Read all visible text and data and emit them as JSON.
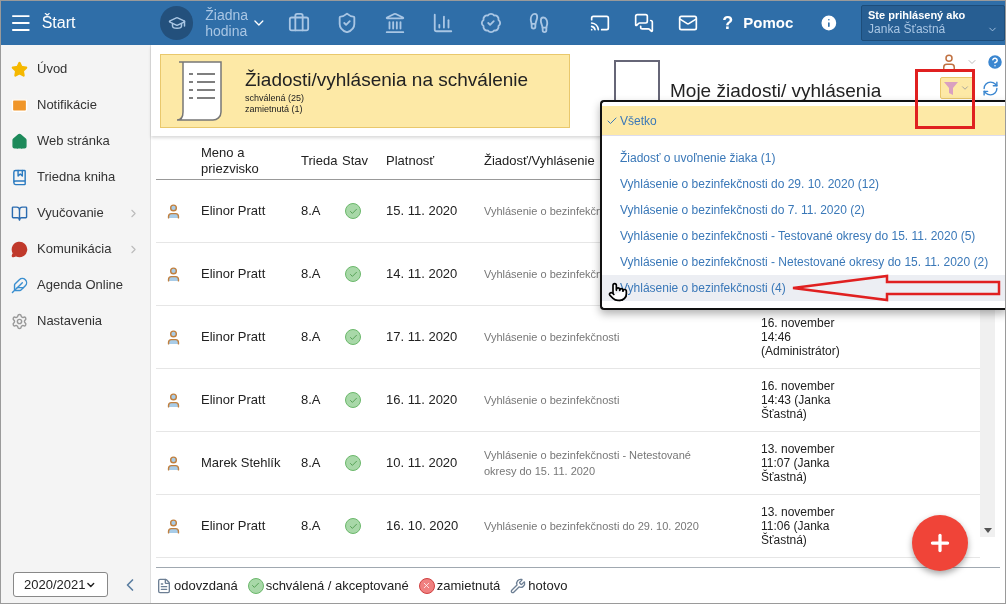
{
  "topbar": {
    "title": "Štart",
    "lesson": "Žiadna hodina",
    "help_mark": "?",
    "help": "Pomoc",
    "user_label": "Ste prihlásený ako",
    "user_name": "Janka Šťastná"
  },
  "sidebar": {
    "items": [
      {
        "label": "Úvod",
        "has_submenu": false
      },
      {
        "label": "Notifikácie",
        "has_submenu": false
      },
      {
        "label": "Web stránka",
        "has_submenu": false
      },
      {
        "label": "Triedna kniha",
        "has_submenu": false
      },
      {
        "label": "Vyučovanie",
        "has_submenu": true
      },
      {
        "label": "Komunikácia",
        "has_submenu": true
      },
      {
        "label": "Agenda Online",
        "has_submenu": false
      },
      {
        "label": "Nastavenia",
        "has_submenu": false
      }
    ],
    "year": "2020/2021"
  },
  "cards": [
    {
      "title": "Žiadosti/vyhlásenia na schválenie",
      "lines": [
        "schválená (25)",
        "zamietnutá (1)"
      ],
      "selected": true
    },
    {
      "title": "Moje žiadosti/ vyhlásenia",
      "selected": false
    }
  ],
  "table": {
    "columns": [
      "Meno a priezvisko",
      "Trieda",
      "Stav",
      "Platnosť",
      "Žiadosť/Vyhlásenie"
    ],
    "rows": [
      {
        "name": "Elinor Pratt",
        "class": "8.A",
        "approved": true,
        "validity": "15. 11. 2020",
        "request": "Vyhlásenie o bezinfekčn"
      },
      {
        "name": "Elinor Pratt",
        "class": "8.A",
        "approved": true,
        "validity": "14. 11. 2020",
        "request": "Vyhlásenie o bezinfekčn"
      },
      {
        "name": "Elinor Pratt",
        "class": "8.A",
        "approved": true,
        "validity": "17. 11. 2020",
        "request": "Vyhlásenie o bezinfekčnosti",
        "changed": "16. november 14:46 (Administrátor)"
      },
      {
        "name": "Elinor Pratt",
        "class": "8.A",
        "approved": true,
        "validity": "16. 11. 2020",
        "request": "Vyhlásenie o bezinfekčnosti",
        "changed": "16. november 14:43 (Janka Šťastná)"
      },
      {
        "name": "Marek Stehlík",
        "class": "8.A",
        "approved": true,
        "validity": "10. 11. 2020",
        "request": "Vyhlásenie o bezinfekčnosti - Netestované okresy do 15. 11. 2020",
        "changed": "13. november 11:07 (Janka Šťastná)"
      },
      {
        "name": "Elinor Pratt",
        "class": "8.A",
        "approved": true,
        "validity": "16. 10. 2020",
        "request": "Vyhlásenie o bezinfekčnosti do 29. 10. 2020",
        "changed": "13. november 11:06 (Janka Šťastná)"
      }
    ]
  },
  "filter_menu": {
    "items": [
      {
        "label": "Všetko",
        "selected": true,
        "hovered": false
      },
      {
        "label": "Žiadosť o uvoľnenie žiaka (1)",
        "selected": false,
        "hovered": false
      },
      {
        "label": "Vyhlásenie o bezinfekčnosti do 29. 10. 2020 (12)",
        "selected": false,
        "hovered": false
      },
      {
        "label": "Vyhlásenie o bezinfekčnosti do 7. 11. 2020 (2)",
        "selected": false,
        "hovered": false
      },
      {
        "label": "Vyhlásenie o bezinfekčnosti - Testované okresy do 15. 11. 2020 (5)",
        "selected": false,
        "hovered": false
      },
      {
        "label": "Vyhlásenie o bezinfekčnosti - Netestované okresy do 15. 11. 2020 (2)",
        "selected": false,
        "hovered": false
      },
      {
        "label": "Vyhlásenie o bezinfekčnosti (4)",
        "selected": false,
        "hovered": true
      }
    ]
  },
  "legend": [
    {
      "kind": "submitted",
      "label": "odovzdaná"
    },
    {
      "kind": "approved",
      "label": "schválená / akceptované"
    },
    {
      "kind": "rejected",
      "label": "zamietnutá"
    },
    {
      "kind": "done",
      "label": "hotovo"
    }
  ]
}
